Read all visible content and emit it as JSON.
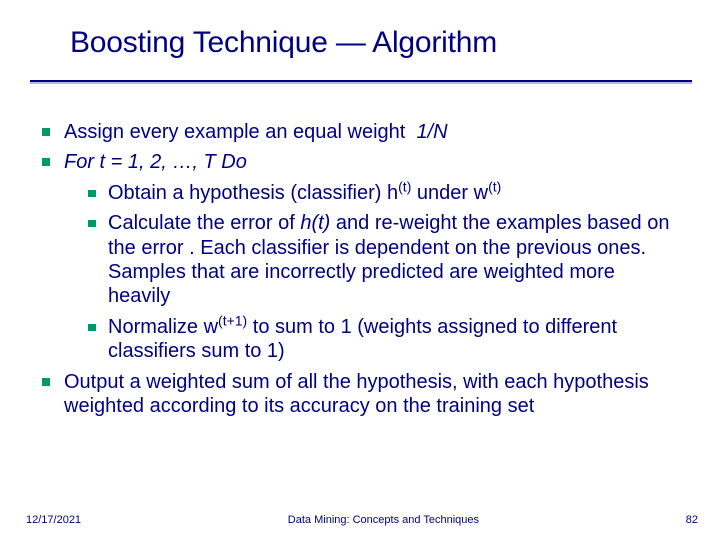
{
  "title": "Boosting Technique — Algorithm",
  "bullets": {
    "0": {
      "pre": "Assign every example an equal weight",
      "em": "1/N"
    },
    "1": {
      "text": "For t = 1, 2, …, T Do"
    },
    "2": {
      "a": "Obtain a hypothesis (classifier) h",
      "sup1": "(t)",
      "b": "under w",
      "sup2": "(t)"
    },
    "3": {
      "a": "Calculate the error of",
      "em": "h(t)",
      "b": "and re-weight the examples based on the error . Each classifier is dependent on the previous ones. Samples that are incorrectly predicted are weighted more heavily"
    },
    "4": {
      "a": "Normalize w",
      "sup": "(t+1)",
      "b": "to sum to 1 (weights assigned to different classifiers sum to 1)"
    },
    "5": {
      "text": "Output a weighted sum of all the hypothesis, with each hypothesis weighted according to its accuracy on the training set"
    }
  },
  "footer": {
    "date": "12/17/2021",
    "center": "Data Mining: Concepts and Techniques",
    "page": "82"
  }
}
